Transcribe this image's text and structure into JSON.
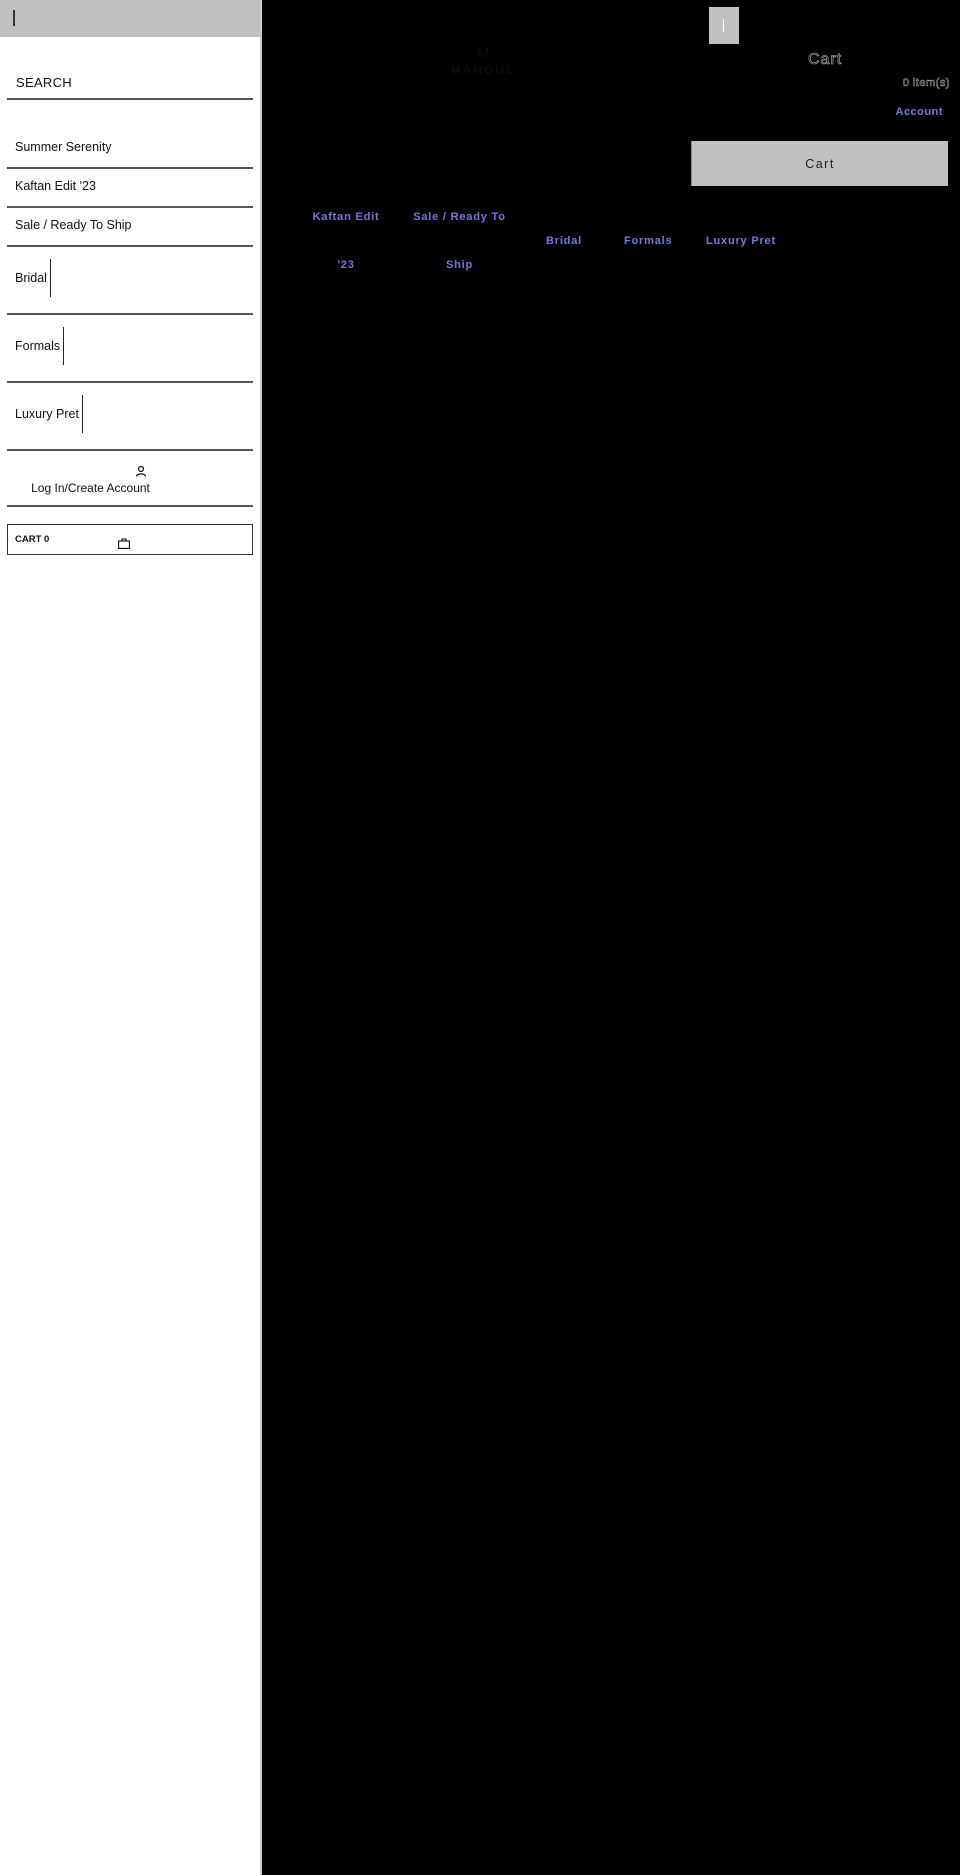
{
  "drawer": {
    "search_label": "SEARCH",
    "menu_items": [
      {
        "label": "Summer Serenity",
        "has_submenu": false
      },
      {
        "label": "Kaftan Edit '23",
        "has_submenu": false
      },
      {
        "label": "Sale / Ready To Ship",
        "has_submenu": false
      },
      {
        "label": "Bridal",
        "has_submenu": true
      },
      {
        "label": "Formals",
        "has_submenu": true
      },
      {
        "label": "Luxury Pret",
        "has_submenu": true
      }
    ],
    "account_label": "Log In/Create Account",
    "cart_label": "CART 0",
    "icons": {
      "account": "user-icon",
      "cart": "shopping-bag-icon",
      "close": "close-icon"
    }
  },
  "header": {
    "logo_mark": "M",
    "logo_text": "MAHGUL",
    "cart_title": "Cart",
    "cart_count": "0 item(s)",
    "account_link": "Account",
    "cart_button": "Cart",
    "menu_toggle_icon": "menu-icon"
  },
  "nav": {
    "kaftan": [
      "Kaftan Edit",
      "'23"
    ],
    "sale": [
      "Sale / Ready To",
      "Ship"
    ],
    "bridal": "Bridal",
    "formals": "Formals",
    "luxury": "Luxury Pret"
  },
  "colors": {
    "link": "#7878d8",
    "drawer_bg": "#ffffff",
    "drawer_header": "#c0c0c0",
    "page_bg": "#000000",
    "button_bg": "#c0c0c0"
  }
}
